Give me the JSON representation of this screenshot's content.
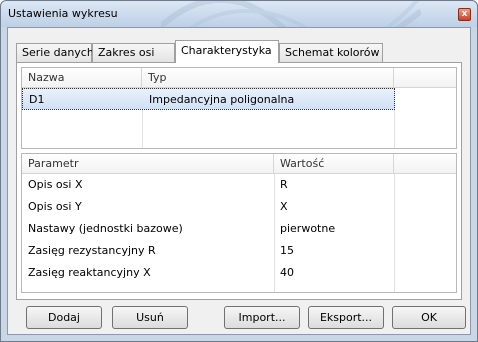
{
  "window": {
    "title": "Ustawienia wykresu",
    "close_glyph": "x"
  },
  "tabs": [
    {
      "label": "Serie danych"
    },
    {
      "label": "Zakres osi"
    },
    {
      "label": "Charakterystyka"
    },
    {
      "label": "Schemat kolorów"
    }
  ],
  "characteristics_table": {
    "columns": [
      "Nazwa",
      "Typ"
    ],
    "rows": [
      {
        "name": "D1",
        "type": "Impedancyjna poligonalna",
        "selected": true
      }
    ]
  },
  "parameters_table": {
    "columns": [
      "Parametr",
      "Wartość"
    ],
    "rows": [
      {
        "parameter": "Opis osi X",
        "value": "R"
      },
      {
        "parameter": "Opis osi Y",
        "value": "X"
      },
      {
        "parameter": "Nastawy (jednostki bazowe)",
        "value": "pierwotne"
      },
      {
        "parameter": "Zasięg rezystancyjny R",
        "value": "15"
      },
      {
        "parameter": "Zasięg reaktancyjny X",
        "value": "40"
      }
    ]
  },
  "buttons": {
    "add": "Dodaj",
    "remove": "Usuń",
    "import": "Import...",
    "export": "Eksport...",
    "ok": "OK"
  },
  "colors": {
    "selection": "#d0e1f5",
    "titlebar": "#c9d6e6",
    "close": "#c7432a"
  }
}
